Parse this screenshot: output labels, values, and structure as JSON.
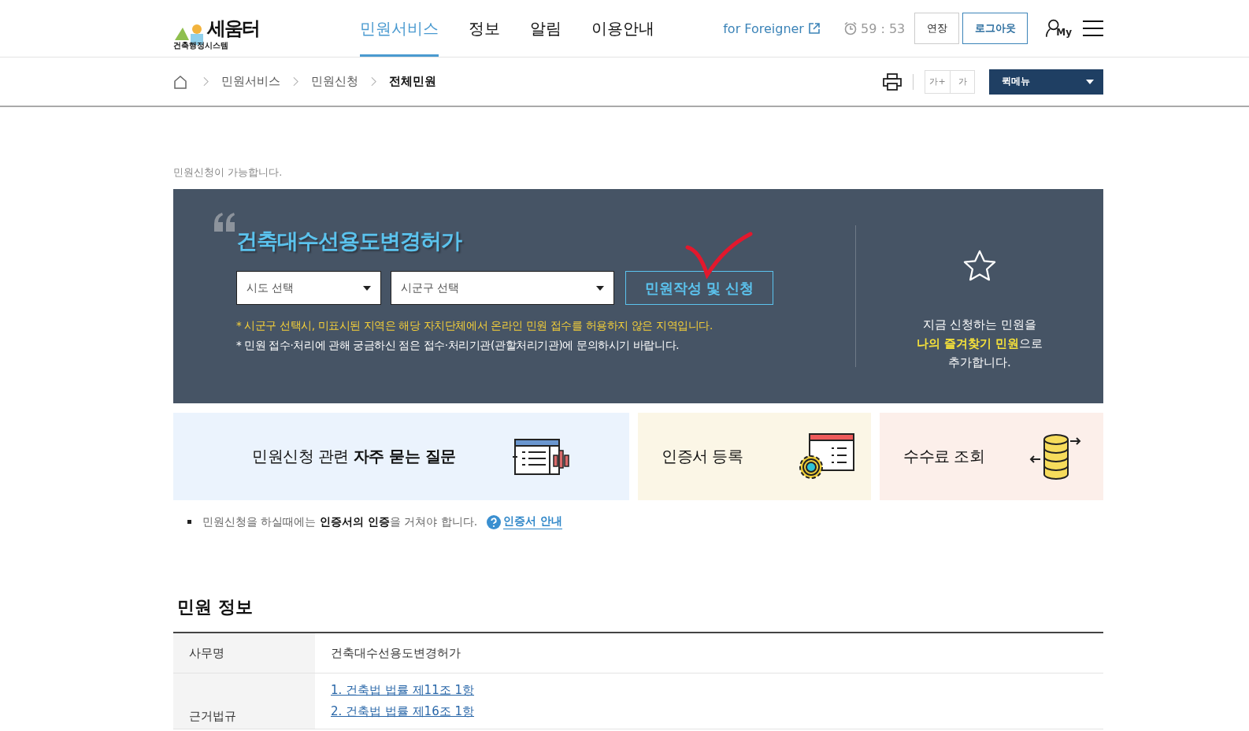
{
  "header": {
    "logo": {
      "name": "세움터",
      "subtitle": "건축행정시스템"
    },
    "nav": [
      {
        "label": "민원서비스",
        "selected": true
      },
      {
        "label": "정보",
        "selected": false
      },
      {
        "label": "알림",
        "selected": false
      },
      {
        "label": "이용안내",
        "selected": false
      }
    ],
    "foreigner_link": "for Foreigner",
    "timer": "59 : 53",
    "extend_button": "연장",
    "logout_button": "로그아웃",
    "my_label": "My"
  },
  "breadcrumb": {
    "items": [
      {
        "label": "민원서비스",
        "selected": false
      },
      {
        "label": "민원신청",
        "selected": false
      },
      {
        "label": "전체민원",
        "selected": true
      }
    ],
    "font_buttons": [
      "가+",
      "가"
    ],
    "quick_menu": "퀵메뉴"
  },
  "notice": "민원신청이 가능합니다.",
  "banner": {
    "title": "건축대수선용도변경허가",
    "selects": [
      {
        "placeholder": "시도 선택"
      },
      {
        "placeholder": "시군구 선택"
      }
    ],
    "apply_button": "민원작성 및 신청",
    "notes": [
      {
        "text": "* 시군구 선택시, 미표시된 지역은 해당 자치단체에서 온라인 민원 접수를 허용하지 않은 지역입니다.",
        "kind": "warning"
      },
      {
        "text": "* 민원 접수·처리에 관해 궁금하신 점은 접수·처리기관(관할처리기관)에 문의하시기 바랍니다.",
        "kind": "info"
      }
    ],
    "favorite_text": "지금 신청하는 민원을\n**나의 즐겨찾기 민원**으로\n추가합니다."
  },
  "cards": [
    {
      "text": "민원신청 관련 **자주 묻는 질문**",
      "kind": "faq",
      "color": "#ebf3fd"
    },
    {
      "text": "인증서 등록",
      "kind": "certificate",
      "color": "#fbf6e6"
    },
    {
      "text": "수수료 조회",
      "kind": "fee",
      "color": "#fcefea"
    }
  ],
  "cert_note": {
    "text": "민원신청을 하실때에는 **인증서의 인증**을 거쳐야 합니다.",
    "link": "인증서 안내"
  },
  "info": {
    "title": "민원 정보",
    "rows": [
      {
        "label": "사무명",
        "kind": "text",
        "values": [
          "건축대수선용도변경허가"
        ]
      },
      {
        "label": "근거법규",
        "kind": "links",
        "values": [
          "1. 건축법 법률 제11조 1항",
          "2. 건축법 법률 제16조 1항"
        ]
      }
    ]
  }
}
